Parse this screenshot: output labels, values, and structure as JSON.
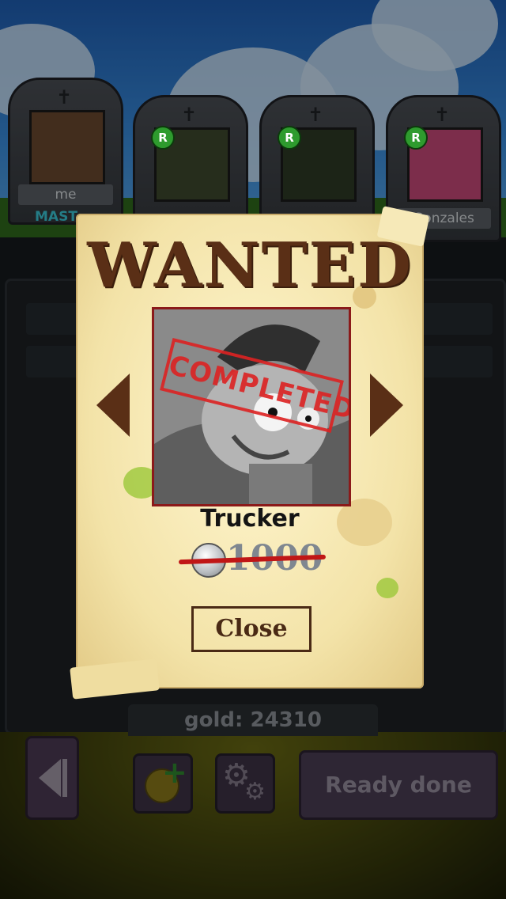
{
  "players": [
    {
      "name": "me",
      "label": "MAST",
      "ready_badge": ""
    },
    {
      "name": "",
      "label": "",
      "ready_badge": "R"
    },
    {
      "name": "",
      "label": "",
      "ready_badge": "R"
    },
    {
      "name": "Gonzales",
      "label": "",
      "ready_badge": "R"
    }
  ],
  "poster": {
    "title": "WANTED",
    "stamp": "COMPLETED",
    "character_name": "Trucker",
    "reward": "1000",
    "close_label": "Close"
  },
  "footer": {
    "gold": "gold: 24310",
    "ready_label": "Ready done"
  },
  "icons": {
    "back": "back-icon",
    "add_coins": "add-coins-icon",
    "settings": "gear-icon",
    "prev": "chevron-left-icon",
    "next": "chevron-right-icon"
  },
  "colors": {
    "poster_ink": "#5a2f16",
    "stamp": "#dd2222",
    "ready_badge": "#2e9b2e",
    "button_purple": "#4b3e55"
  }
}
